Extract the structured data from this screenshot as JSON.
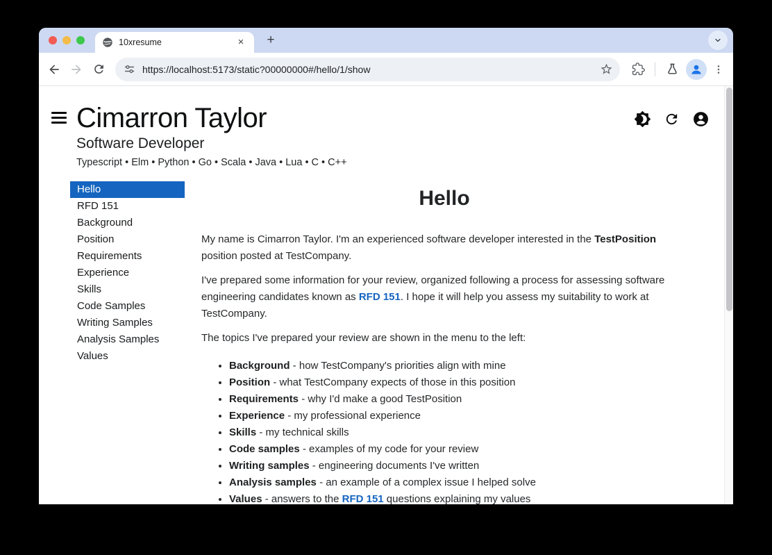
{
  "browser": {
    "tab": {
      "title": "10xresume",
      "close_glyph": "×"
    },
    "new_tab_glyph": "+",
    "url": "https://localhost:5173/static?00000000#/hello/1/show"
  },
  "header": {
    "name": "Cimarron Taylor",
    "role": "Software Developer",
    "skills": "Typescript • Elm • Python • Go • Scala • Java • Lua • C • C++"
  },
  "sidebar": {
    "selected_index": 0,
    "items": [
      "Hello",
      "RFD 151",
      "Background",
      "Position",
      "Requirements",
      "Experience",
      "Skills",
      "Code Samples",
      "Writing Samples",
      "Analysis Samples",
      "Values"
    ]
  },
  "main": {
    "title": "Hello",
    "paragraphs": [
      {
        "runs": [
          {
            "t": "My name is Cimarron Taylor. I'm an experienced software developer interested in the "
          },
          {
            "t": "TestPosition",
            "s": "b"
          },
          {
            "t": " position posted at TestCompany."
          }
        ]
      },
      {
        "runs": [
          {
            "t": "I've prepared some information for your review, organized following a process for assessing software engineering candidates known as "
          },
          {
            "t": "RFD 151",
            "s": "link"
          },
          {
            "t": ". I hope it will help you assess my suitability to work at TestCompany."
          }
        ]
      },
      {
        "runs": [
          {
            "t": "The topics I've prepared your review are shown in the menu to the left:"
          }
        ]
      }
    ],
    "bullets": [
      {
        "runs": [
          {
            "t": "Background",
            "s": "b"
          },
          {
            "t": " - how TestCompany's priorities align with mine"
          }
        ]
      },
      {
        "runs": [
          {
            "t": "Position",
            "s": "b"
          },
          {
            "t": " - what TestCompany expects of those in this position"
          }
        ]
      },
      {
        "runs": [
          {
            "t": "Requirements",
            "s": "b"
          },
          {
            "t": " - why I'd make a good TestPosition"
          }
        ]
      },
      {
        "runs": [
          {
            "t": "Experience",
            "s": "b"
          },
          {
            "t": " - my professional experience"
          }
        ]
      },
      {
        "runs": [
          {
            "t": "Skills",
            "s": "b"
          },
          {
            "t": " - my technical skills"
          }
        ]
      },
      {
        "runs": [
          {
            "t": "Code samples",
            "s": "b"
          },
          {
            "t": " - examples of my code for your review"
          }
        ]
      },
      {
        "runs": [
          {
            "t": "Writing samples",
            "s": "b"
          },
          {
            "t": " - engineering documents I've written"
          }
        ]
      },
      {
        "runs": [
          {
            "t": "Analysis samples",
            "s": "b"
          },
          {
            "t": " - an example of a complex issue I helped solve"
          }
        ]
      },
      {
        "runs": [
          {
            "t": "Values",
            "s": "b"
          },
          {
            "t": " - answers to the "
          },
          {
            "t": "RFD 151",
            "s": "link"
          },
          {
            "t": " questions explaining my values"
          }
        ]
      }
    ]
  },
  "colors": {
    "accent": "#1565c0",
    "link": "#1565c0",
    "tabstrip": "#cdd9f2",
    "traffic_red": "#f25c54",
    "traffic_yellow": "#f3bb49",
    "traffic_green": "#3dc84e"
  }
}
